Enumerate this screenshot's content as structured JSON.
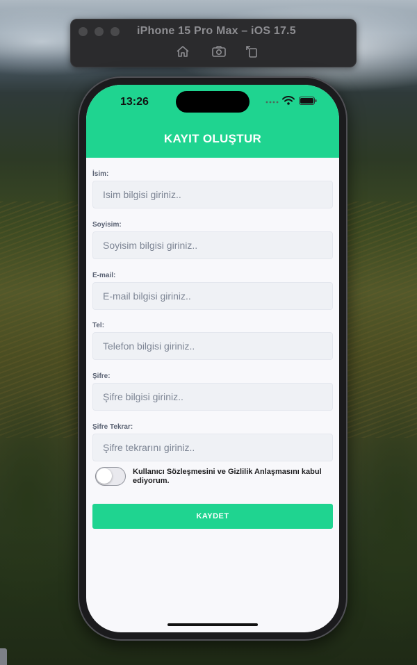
{
  "simulator": {
    "title": "iPhone 15 Pro Max – iOS 17.5",
    "buttons": [
      "home-icon",
      "screenshot-icon",
      "rotate-icon"
    ]
  },
  "status_bar": {
    "time": "13:26"
  },
  "header": {
    "title": "KAYIT OLUŞTUR"
  },
  "form": {
    "fields": [
      {
        "label": "İsim:",
        "placeholder": "Isim bilgisi giriniz..",
        "value": ""
      },
      {
        "label": "Soyisim:",
        "placeholder": "Soyisim bilgisi giriniz..",
        "value": ""
      },
      {
        "label": "E-mail:",
        "placeholder": "E-mail bilgisi giriniz..",
        "value": ""
      },
      {
        "label": "Tel:",
        "placeholder": "Telefon bilgisi giriniz..",
        "value": ""
      },
      {
        "label": "Şifre:",
        "placeholder": "Şifre bilgisi giriniz..",
        "value": ""
      },
      {
        "label": "Şifre Tekrar:",
        "placeholder": "Şifre tekrarını giriniz..",
        "value": ""
      }
    ],
    "agreement": {
      "text": "Kullanıcı Sözleşmesini ve Gizlilik Anlaşmasını kabul ediyorum.",
      "toggle_on": false
    },
    "submit_label": "KAYDET"
  },
  "colors": {
    "accent": "#1fd490",
    "input_bg": "#eff1f5",
    "label": "#5a6273"
  }
}
